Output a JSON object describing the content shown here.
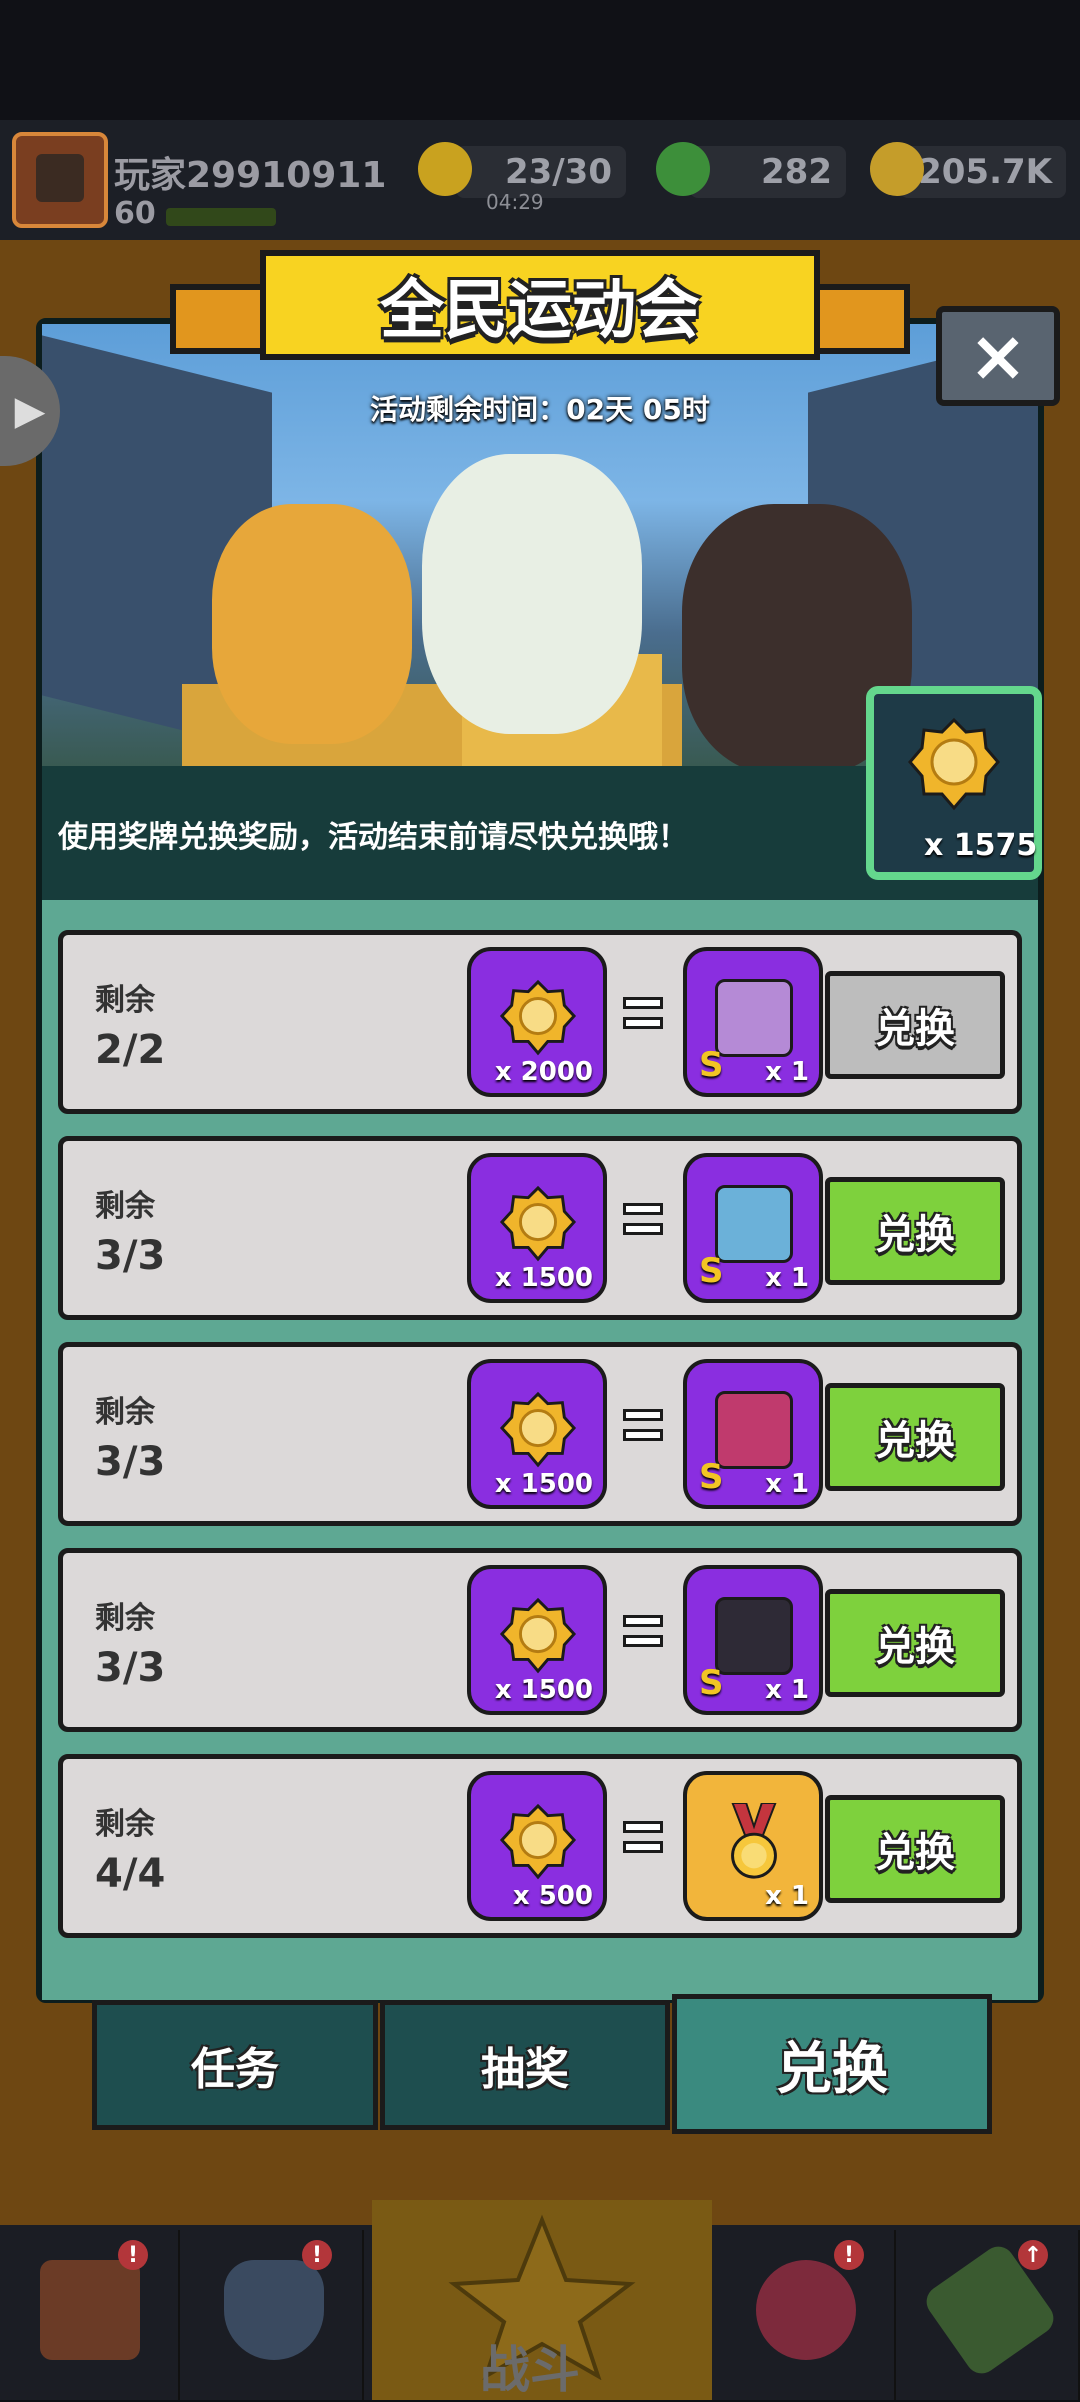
{
  "player": {
    "name": "玩家29910911",
    "level": "60"
  },
  "resources": {
    "energy": "23/30",
    "energy_timer": "04:29",
    "gems": "282",
    "coins": "205.7K"
  },
  "event": {
    "title": "全民运动会",
    "time_left": "活动剩余时间：02天 05时",
    "info": "使用奖牌兑换奖励，活动结束前请尽快兑换哦！",
    "medal_count": "x 1575",
    "close_label": "×"
  },
  "rows": [
    {
      "remain_label": "剩余",
      "remain": "2/2",
      "cost": "x 2000",
      "reward_grade": "S",
      "reward_count": "x 1",
      "button": "兑换",
      "enabled": false
    },
    {
      "remain_label": "剩余",
      "remain": "3/3",
      "cost": "x 1500",
      "reward_grade": "S",
      "reward_count": "x 1",
      "button": "兑换",
      "enabled": true
    },
    {
      "remain_label": "剩余",
      "remain": "3/3",
      "cost": "x 1500",
      "reward_grade": "S",
      "reward_count": "x 1",
      "button": "兑换",
      "enabled": true
    },
    {
      "remain_label": "剩余",
      "remain": "3/3",
      "cost": "x 1500",
      "reward_grade": "S",
      "reward_count": "x 1",
      "button": "兑换",
      "enabled": true
    },
    {
      "remain_label": "剩余",
      "remain": "4/4",
      "cost": "x 500",
      "reward_grade": "",
      "reward_count": "x 1",
      "button": "兑换",
      "enabled": true
    }
  ],
  "tabs": [
    "任务",
    "抽奖",
    "兑换"
  ],
  "nav": {
    "battle": "战斗"
  },
  "colors": {
    "enabled_button": "#7ed13d",
    "disabled_button": "#bdbdbd",
    "slot_purple": "#8a2ee0",
    "slot_gold": "#f2b53b"
  }
}
